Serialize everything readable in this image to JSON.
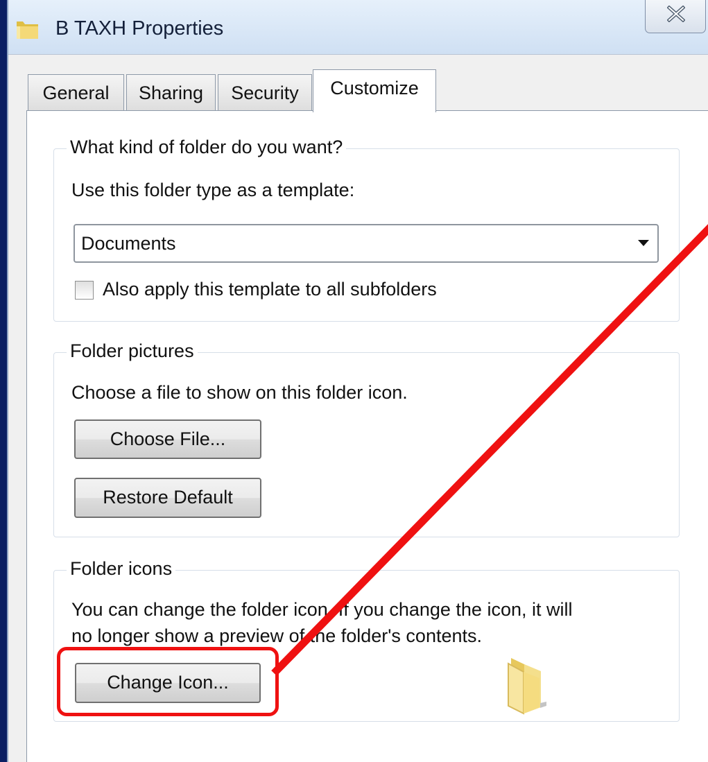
{
  "window": {
    "title": "B TAXH Properties"
  },
  "tabs": [
    {
      "label": "General"
    },
    {
      "label": "Sharing"
    },
    {
      "label": "Security"
    },
    {
      "label": "Customize"
    }
  ],
  "active_tab": "Customize",
  "folder_type_group": {
    "title": "What kind of folder do you want?",
    "prompt": "Use this folder type as a template:",
    "selected_template": "Documents",
    "apply_subfolders_label": "Also apply this template to all subfolders",
    "apply_subfolders_checked": false
  },
  "folder_pictures_group": {
    "title": "Folder pictures",
    "description": "Choose a file to show on this folder icon.",
    "choose_file_label": "Choose File...",
    "restore_default_label": "Restore Default"
  },
  "folder_icons_group": {
    "title": "Folder icons",
    "description_line1": "You can change the folder icon. If you change the icon, it will",
    "description_line2": "no longer show a preview of the folder's contents.",
    "change_icon_label": "Change Icon..."
  },
  "icons": {
    "title_icon": "folder-icon",
    "close": "close-icon",
    "dropdown": "chevron-down-icon",
    "preview": "folder-preview-icon"
  },
  "colors": {
    "annotation": "#ef1111",
    "desktop_background": "#0b1f63",
    "folder_yellow": "#f2d774"
  }
}
